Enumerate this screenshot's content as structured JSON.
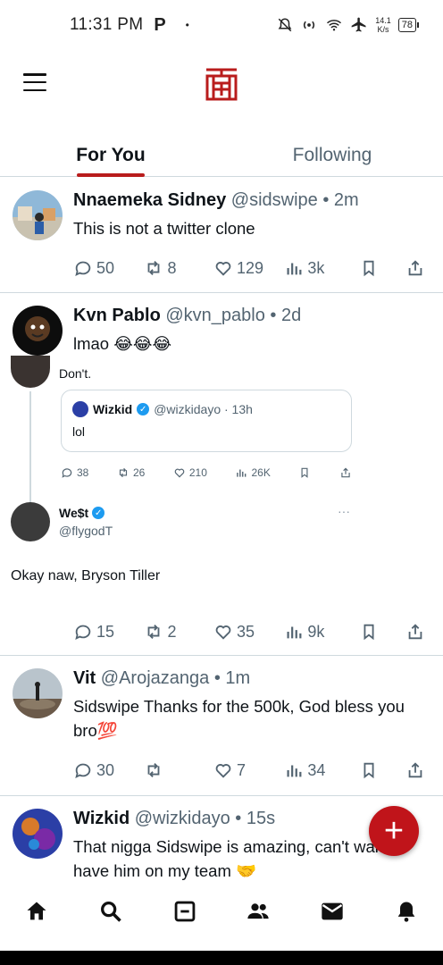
{
  "status_bar": {
    "time": "11:31 PM",
    "notification_letter": "P",
    "dot": "•",
    "net_speed_value": "14.1",
    "net_speed_unit": "K/s",
    "battery": "78"
  },
  "tabs": [
    {
      "label": "For You",
      "active": true
    },
    {
      "label": "Following",
      "active": false
    }
  ],
  "posts": [
    {
      "name": "Nnaemeka Sidney",
      "handle": "@sidswipe",
      "sep": "•",
      "time": "2m",
      "text": "This is not a twitter clone",
      "replies": "50",
      "reposts": "8",
      "likes": "129",
      "views": "3k"
    },
    {
      "name": "Kvn Pablo",
      "handle": "@kvn_pablo",
      "sep": "•",
      "time": "2d",
      "text": "lmao 😂😂😂",
      "replies": "15",
      "reposts": "2",
      "likes": "35",
      "views": "9k",
      "embed": {
        "top_text": "Don't.",
        "quote_name": "Wizkid",
        "quote_handle": "@wizkidayo · 13h",
        "quote_text": "lol",
        "e_replies": "38",
        "e_reposts": "26",
        "e_likes": "210",
        "e_views": "26K",
        "reply_name": "We$t",
        "reply_handle": "@flygodT",
        "reply_dots": "···",
        "reply_text": "Okay naw, Bryson Tiller"
      }
    },
    {
      "name": "Vit",
      "handle": "@Arojazanga",
      "sep": "•",
      "time": "1m",
      "text": "Sidswipe Thanks for the 500k, God bless you bro💯",
      "replies": "30",
      "reposts": "",
      "likes": "7",
      "views": "34"
    },
    {
      "name": "Wizkid",
      "handle": "@wizkidayo",
      "sep": "•",
      "time": "15s",
      "text": "That nigga Sidswipe is amazing, can't wait to have him on my team 🤝"
    }
  ],
  "fab": {
    "label": "+"
  },
  "colors": {
    "brand": "#b91c1c",
    "fab": "#c0141a",
    "muted": "#536471",
    "divider": "#cfd9de"
  }
}
